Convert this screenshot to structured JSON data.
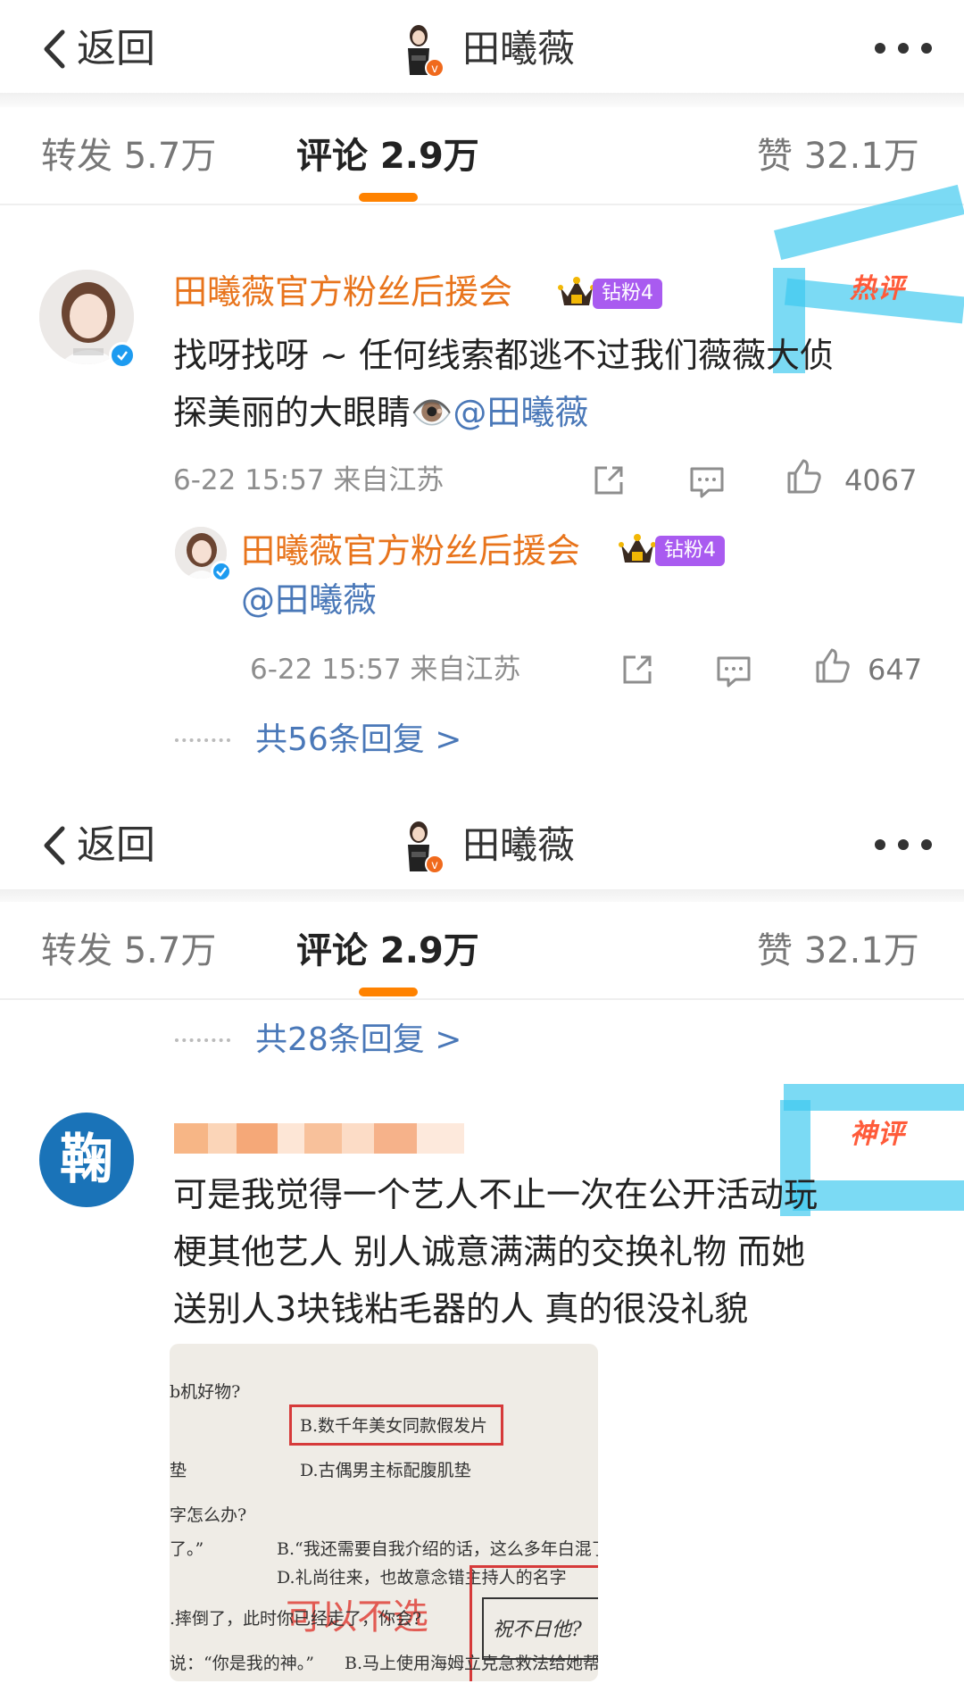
{
  "nav": {
    "back_label": "返回",
    "title": "田曦薇"
  },
  "tabs": {
    "repost": "转发 5.7万",
    "comment": "评论 2.9万",
    "like": "赞 32.1万"
  },
  "screen1": {
    "comment": {
      "username": "田曦薇官方粉丝后援会",
      "fan_badge": "钻粉4",
      "tag": "热评",
      "text_line1": "找呀找呀 ~ 任何线索都逃不过我们薇薇大侦",
      "text_line2_prefix": "探美丽的大眼睛👁️",
      "mention": "@田曦薇",
      "meta": "6-22 15:57 来自江苏",
      "likes": "4067"
    },
    "reply": {
      "username": "田曦薇官方粉丝后援会",
      "fan_badge": "钻粉4",
      "text": "@田曦薇",
      "meta": "6-22 15:57 来自江苏",
      "likes": "647"
    },
    "replies_link": "共56条回复 >"
  },
  "screen2": {
    "replies_link": "共28条回复 >",
    "comment": {
      "avatar_char": "鞠",
      "tag": "神评",
      "line1": "可是我觉得一个艺人不止一次在公开活动玩",
      "line2": "梗其他艺人 别人诚意满满的交换礼物 而她",
      "line3": "送别人3块钱粘毛器的人 真的很没礼貌"
    },
    "photo": {
      "q1_tail": "b机好物?",
      "opt_b": "B.数千年美女同款假发片",
      "opt_c_tail": "垫",
      "opt_d": "D.古偶男主标配腹肌垫",
      "q2_tail": "字怎么办?",
      "opt_a2_tail": "了。”",
      "opt_b2": "B.“我还需要自我介绍的话，这么多年白混了。”",
      "opt_d2": "D.礼尚往来，也故意念错主持人的名字",
      "q3": ".摔倒了，此时你已经走了，你会?",
      "opt_a3": "说：“你是我的神。”",
      "opt_b3": "B.马上使用海姆立克急救法给她帮",
      "red_note": "可以不选",
      "handwriting": "祝不日他?"
    }
  }
}
